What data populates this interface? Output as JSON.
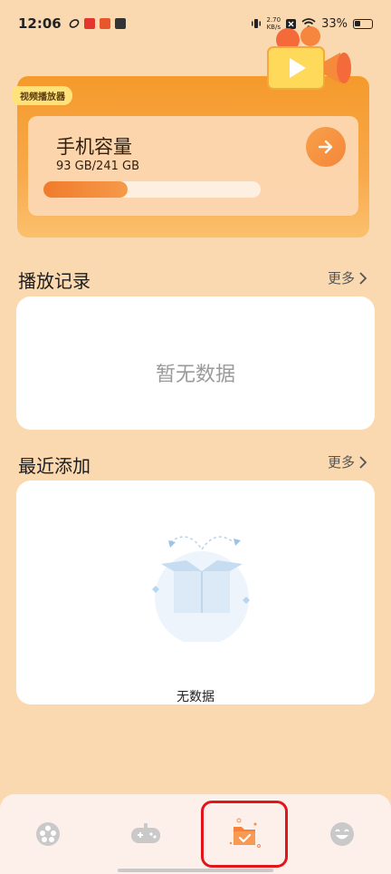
{
  "status_bar": {
    "time": "12:06",
    "net_speed_value": "2.70",
    "net_speed_unit": "KB/s",
    "battery_percent": "33%"
  },
  "player_card": {
    "tag": "视频播放器",
    "storage_title": "手机容量",
    "storage_value": "93 GB/241 GB",
    "storage_used_fraction": 0.386
  },
  "play_history": {
    "title": "播放记录",
    "more_label": "更多",
    "empty_text": "暂无数据"
  },
  "recent_added": {
    "title": "最近添加",
    "more_label": "更多",
    "empty_text": "无数据"
  },
  "bottom_nav": {
    "items": [
      {
        "icon": "film-reel-icon"
      },
      {
        "icon": "gamepad-icon"
      },
      {
        "icon": "folder-check-icon",
        "active": true
      },
      {
        "icon": "smiley-icon"
      }
    ]
  },
  "colors": {
    "background": "#fbd9b0",
    "accent": "#f59a2b",
    "highlight": "#e0161b"
  }
}
